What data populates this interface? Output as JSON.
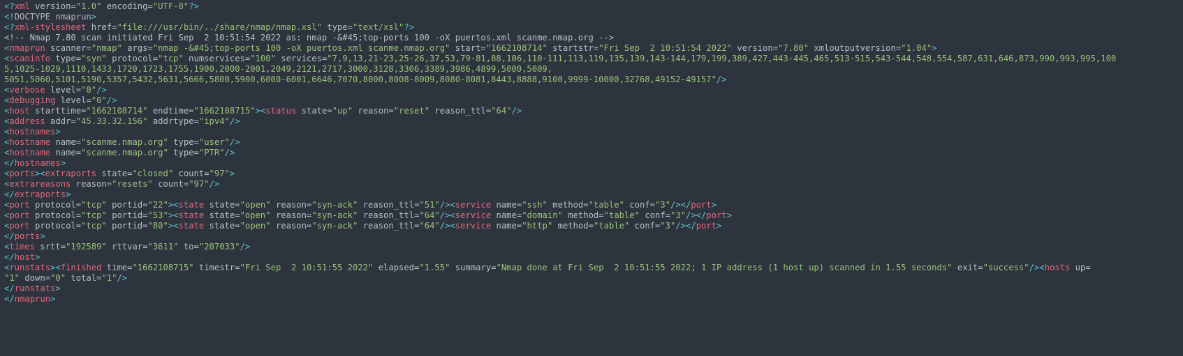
{
  "colors": {
    "background": "#2e343e",
    "tag": "#e0687a",
    "bracket": "#5ec4cf",
    "attribute": "#b8bec8",
    "value": "#98c379",
    "text": "#c6ccd6",
    "comment": "#b8bec8"
  },
  "lines": [
    [
      [
        "b",
        "<?"
      ],
      [
        "t",
        "xml"
      ],
      [
        "a",
        " version="
      ],
      [
        "v",
        "\"1.0\""
      ],
      [
        "a",
        " encoding="
      ],
      [
        "v",
        "\"UTF-8\""
      ],
      [
        "b",
        "?>"
      ]
    ],
    [
      [
        "b",
        "<!"
      ],
      [
        "g",
        "DOCTYPE nmaprun"
      ],
      [
        "b",
        ">"
      ]
    ],
    [
      [
        "b",
        "<?"
      ],
      [
        "t",
        "xml-stylesheet"
      ],
      [
        "a",
        " href="
      ],
      [
        "v",
        "\"file:///usr/bin/../share/nmap/nmap.xsl\""
      ],
      [
        "a",
        " type="
      ],
      [
        "v",
        "\"text/xsl\""
      ],
      [
        "b",
        "?>"
      ]
    ],
    [
      [
        "c",
        "<!-- Nmap 7.80 scan initiated Fri Sep  2 10:51:54 2022 as: nmap -&#45;top-ports 100 -oX puertos.xml scanme.nmap.org -->"
      ]
    ],
    [
      [
        "b",
        "<"
      ],
      [
        "t",
        "nmaprun"
      ],
      [
        "a",
        " scanner="
      ],
      [
        "v",
        "\"nmap\""
      ],
      [
        "a",
        " args="
      ],
      [
        "v",
        "\"nmap -&#45;top-ports 100 -oX puertos.xml scanme.nmap.org\""
      ],
      [
        "a",
        " start="
      ],
      [
        "v",
        "\"1662108714\""
      ],
      [
        "a",
        " startstr="
      ],
      [
        "v",
        "\"Fri Sep  2 10:51:54 2022\""
      ],
      [
        "a",
        " version="
      ],
      [
        "v",
        "\"7.80\""
      ],
      [
        "a",
        " xmloutputversion="
      ],
      [
        "v",
        "\"1.04\""
      ],
      [
        "b",
        ">"
      ]
    ],
    [
      [
        "b",
        "<"
      ],
      [
        "t",
        "scaninfo"
      ],
      [
        "a",
        " type="
      ],
      [
        "v",
        "\"syn\""
      ],
      [
        "a",
        " protocol="
      ],
      [
        "v",
        "\"tcp\""
      ],
      [
        "a",
        " numservices="
      ],
      [
        "v",
        "\"100\""
      ],
      [
        "a",
        " services="
      ],
      [
        "v",
        "\"7,9,13,21-23,25-26,37,53,79-81,88,106,110-111,113,119,135,139,143-144,179,199,389,427,443-445,465,513-515,543-544,548,554,587,631,646,873,990,993,995,100"
      ]
    ],
    [
      [
        "v",
        "5,1025-1029,1110,1433,1720,1723,1755,1900,2000-2001,2049,2121,2717,3000,3128,3306,3389,3986,4899,5000,5009,"
      ]
    ],
    [
      [
        "v",
        "5051,5060,5101,5190,5357,5432,5631,5666,5800,5900,6000-6001,6646,7070,8000,8008-8009,8080-8081,8443,8888,9100,9999-10000,32768,49152-49157\""
      ],
      [
        "b",
        "/>"
      ]
    ],
    [
      [
        "b",
        "<"
      ],
      [
        "t",
        "verbose"
      ],
      [
        "a",
        " level="
      ],
      [
        "v",
        "\"0\""
      ],
      [
        "b",
        "/>"
      ]
    ],
    [
      [
        "b",
        "<"
      ],
      [
        "t",
        "debugging"
      ],
      [
        "a",
        " level="
      ],
      [
        "v",
        "\"0\""
      ],
      [
        "b",
        "/>"
      ]
    ],
    [
      [
        "b",
        "<"
      ],
      [
        "t",
        "host"
      ],
      [
        "a",
        " starttime="
      ],
      [
        "v",
        "\"1662108714\""
      ],
      [
        "a",
        " endtime="
      ],
      [
        "v",
        "\"1662108715\""
      ],
      [
        "b",
        "><"
      ],
      [
        "t",
        "status"
      ],
      [
        "a",
        " state="
      ],
      [
        "v",
        "\"up\""
      ],
      [
        "a",
        " reason="
      ],
      [
        "v",
        "\"reset\""
      ],
      [
        "a",
        " reason_ttl="
      ],
      [
        "v",
        "\"64\""
      ],
      [
        "b",
        "/>"
      ]
    ],
    [
      [
        "b",
        "<"
      ],
      [
        "t",
        "address"
      ],
      [
        "a",
        " addr="
      ],
      [
        "v",
        "\"45.33.32.156\""
      ],
      [
        "a",
        " addrtype="
      ],
      [
        "v",
        "\"ipv4\""
      ],
      [
        "b",
        "/>"
      ]
    ],
    [
      [
        "b",
        "<"
      ],
      [
        "t",
        "hostnames"
      ],
      [
        "b",
        ">"
      ]
    ],
    [
      [
        "b",
        "<"
      ],
      [
        "t",
        "hostname"
      ],
      [
        "a",
        " name="
      ],
      [
        "v",
        "\"scanme.nmap.org\""
      ],
      [
        "a",
        " type="
      ],
      [
        "v",
        "\"user\""
      ],
      [
        "b",
        "/>"
      ]
    ],
    [
      [
        "b",
        "<"
      ],
      [
        "t",
        "hostname"
      ],
      [
        "a",
        " name="
      ],
      [
        "v",
        "\"scanme.nmap.org\""
      ],
      [
        "a",
        " type="
      ],
      [
        "v",
        "\"PTR\""
      ],
      [
        "b",
        "/>"
      ]
    ],
    [
      [
        "b",
        "</"
      ],
      [
        "t",
        "hostnames"
      ],
      [
        "b",
        ">"
      ]
    ],
    [
      [
        "b",
        "<"
      ],
      [
        "t",
        "ports"
      ],
      [
        "b",
        "><"
      ],
      [
        "t",
        "extraports"
      ],
      [
        "a",
        " state="
      ],
      [
        "v",
        "\"closed\""
      ],
      [
        "a",
        " count="
      ],
      [
        "v",
        "\"97\""
      ],
      [
        "b",
        ">"
      ]
    ],
    [
      [
        "b",
        "<"
      ],
      [
        "t",
        "extrareasons"
      ],
      [
        "a",
        " reason="
      ],
      [
        "v",
        "\"resets\""
      ],
      [
        "a",
        " count="
      ],
      [
        "v",
        "\"97\""
      ],
      [
        "b",
        "/>"
      ]
    ],
    [
      [
        "b",
        "</"
      ],
      [
        "t",
        "extraports"
      ],
      [
        "b",
        ">"
      ]
    ],
    [
      [
        "b",
        "<"
      ],
      [
        "t",
        "port"
      ],
      [
        "a",
        " protocol="
      ],
      [
        "v",
        "\"tcp\""
      ],
      [
        "a",
        " portid="
      ],
      [
        "v",
        "\"22\""
      ],
      [
        "b",
        "><"
      ],
      [
        "t",
        "state"
      ],
      [
        "a",
        " state="
      ],
      [
        "v",
        "\"open\""
      ],
      [
        "a",
        " reason="
      ],
      [
        "v",
        "\"syn-ack\""
      ],
      [
        "a",
        " reason_ttl="
      ],
      [
        "v",
        "\"51\""
      ],
      [
        "b",
        "/><"
      ],
      [
        "t",
        "service"
      ],
      [
        "a",
        " name="
      ],
      [
        "v",
        "\"ssh\""
      ],
      [
        "a",
        " method="
      ],
      [
        "v",
        "\"table\""
      ],
      [
        "a",
        " conf="
      ],
      [
        "v",
        "\"3\""
      ],
      [
        "b",
        "/></"
      ],
      [
        "t",
        "port"
      ],
      [
        "b",
        ">"
      ]
    ],
    [
      [
        "b",
        "<"
      ],
      [
        "t",
        "port"
      ],
      [
        "a",
        " protocol="
      ],
      [
        "v",
        "\"tcp\""
      ],
      [
        "a",
        " portid="
      ],
      [
        "v",
        "\"53\""
      ],
      [
        "b",
        "><"
      ],
      [
        "t",
        "state"
      ],
      [
        "a",
        " state="
      ],
      [
        "v",
        "\"open\""
      ],
      [
        "a",
        " reason="
      ],
      [
        "v",
        "\"syn-ack\""
      ],
      [
        "a",
        " reason_ttl="
      ],
      [
        "v",
        "\"64\""
      ],
      [
        "b",
        "/><"
      ],
      [
        "t",
        "service"
      ],
      [
        "a",
        " name="
      ],
      [
        "v",
        "\"domain\""
      ],
      [
        "a",
        " method="
      ],
      [
        "v",
        "\"table\""
      ],
      [
        "a",
        " conf="
      ],
      [
        "v",
        "\"3\""
      ],
      [
        "b",
        "/></"
      ],
      [
        "t",
        "port"
      ],
      [
        "b",
        ">"
      ]
    ],
    [
      [
        "b",
        "<"
      ],
      [
        "t",
        "port"
      ],
      [
        "a",
        " protocol="
      ],
      [
        "v",
        "\"tcp\""
      ],
      [
        "a",
        " portid="
      ],
      [
        "v",
        "\"80\""
      ],
      [
        "b",
        "><"
      ],
      [
        "t",
        "state"
      ],
      [
        "a",
        " state="
      ],
      [
        "v",
        "\"open\""
      ],
      [
        "a",
        " reason="
      ],
      [
        "v",
        "\"syn-ack\""
      ],
      [
        "a",
        " reason_ttl="
      ],
      [
        "v",
        "\"64\""
      ],
      [
        "b",
        "/><"
      ],
      [
        "t",
        "service"
      ],
      [
        "a",
        " name="
      ],
      [
        "v",
        "\"http\""
      ],
      [
        "a",
        " method="
      ],
      [
        "v",
        "\"table\""
      ],
      [
        "a",
        " conf="
      ],
      [
        "v",
        "\"3\""
      ],
      [
        "b",
        "/></"
      ],
      [
        "t",
        "port"
      ],
      [
        "b",
        ">"
      ]
    ],
    [
      [
        "b",
        "</"
      ],
      [
        "t",
        "ports"
      ],
      [
        "b",
        ">"
      ]
    ],
    [
      [
        "b",
        "<"
      ],
      [
        "t",
        "times"
      ],
      [
        "a",
        " srtt="
      ],
      [
        "v",
        "\"192589\""
      ],
      [
        "a",
        " rttvar="
      ],
      [
        "v",
        "\"3611\""
      ],
      [
        "a",
        " to="
      ],
      [
        "v",
        "\"207033\""
      ],
      [
        "b",
        "/>"
      ]
    ],
    [
      [
        "b",
        "</"
      ],
      [
        "t",
        "host"
      ],
      [
        "b",
        ">"
      ]
    ],
    [
      [
        "b",
        "<"
      ],
      [
        "t",
        "runstats"
      ],
      [
        "b",
        "><"
      ],
      [
        "t",
        "finished"
      ],
      [
        "a",
        " time="
      ],
      [
        "v",
        "\"1662108715\""
      ],
      [
        "a",
        " timestr="
      ],
      [
        "v",
        "\"Fri Sep  2 10:51:55 2022\""
      ],
      [
        "a",
        " elapsed="
      ],
      [
        "v",
        "\"1.55\""
      ],
      [
        "a",
        " summary="
      ],
      [
        "v",
        "\"Nmap done at Fri Sep  2 10:51:55 2022; 1 IP address (1 host up) scanned in 1.55 seconds\""
      ],
      [
        "a",
        " exit="
      ],
      [
        "v",
        "\"success\""
      ],
      [
        "b",
        "/><"
      ],
      [
        "t",
        "hosts"
      ],
      [
        "a",
        " up="
      ]
    ],
    [
      [
        "v",
        "\"1\""
      ],
      [
        "a",
        " down="
      ],
      [
        "v",
        "\"0\""
      ],
      [
        "a",
        " total="
      ],
      [
        "v",
        "\"1\""
      ],
      [
        "b",
        "/>"
      ]
    ],
    [
      [
        "b",
        "</"
      ],
      [
        "t",
        "runstats"
      ],
      [
        "b",
        ">"
      ]
    ],
    [
      [
        "b",
        "</"
      ],
      [
        "t",
        "nmaprun"
      ],
      [
        "b",
        ">"
      ]
    ]
  ]
}
